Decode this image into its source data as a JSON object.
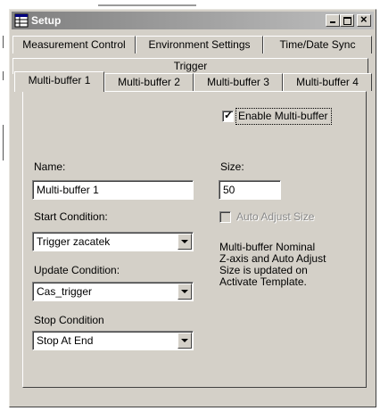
{
  "window": {
    "title": "Setup",
    "icon": "table-icon",
    "controls": [
      "minimize-icon",
      "maximize-icon",
      "close-icon"
    ]
  },
  "tabs": {
    "row1": [
      "Measurement Control",
      "Environment Settings",
      "Time/Date Sync"
    ],
    "row2": [
      "Trigger"
    ],
    "row3": [
      "Multi-buffer 1",
      "Multi-buffer 2",
      "Multi-buffer 3",
      "Multi-buffer 4"
    ],
    "active": "Multi-buffer 1"
  },
  "form": {
    "enable_label": "Enable Multi-buffer",
    "enable_checked": true,
    "name_label": "Name:",
    "name_value": "Multi-buffer 1",
    "size_label": "Size:",
    "size_value": "50",
    "auto_adjust_label": "Auto Adjust Size",
    "auto_adjust_checked": false,
    "start_label": "Start Condition:",
    "start_value": "Trigger zacatek",
    "update_label": "Update Condition:",
    "update_value": "Cas_trigger",
    "stop_label": "Stop Condition",
    "stop_value": "Stop At End",
    "note_lines": [
      "Multi-buffer Nominal",
      "Z-axis and Auto Adjust",
      "Size is updated on",
      "Activate Template."
    ]
  }
}
